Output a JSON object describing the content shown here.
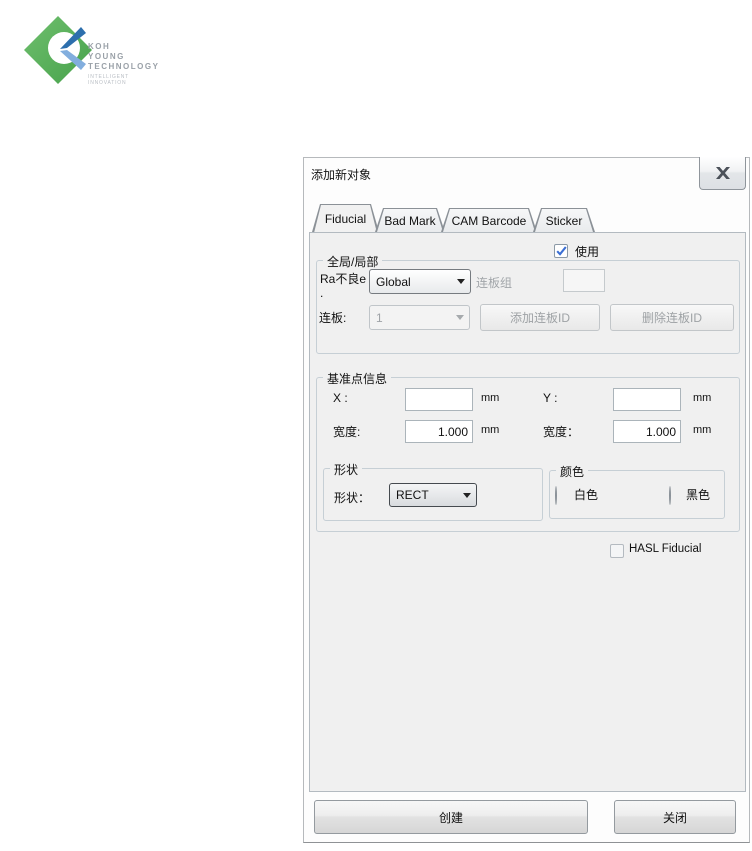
{
  "logo": {
    "brand_lines": [
      "KOH",
      "YOUNG",
      "TECHNOLOGY"
    ],
    "tagline_lines": [
      "INTELLIGENT",
      "INNOVATION"
    ],
    "colors": {
      "green": "#54ad55",
      "blue_dark": "#2d6fad",
      "blue_light": "#82aede"
    }
  },
  "dialog": {
    "title": "添加新对象",
    "tabs": [
      {
        "label": "Fiducial",
        "active": true
      },
      {
        "label": "Bad Mark",
        "active": false
      },
      {
        "label": "CAM Barcode",
        "active": false
      },
      {
        "label": "Sticker",
        "active": false
      }
    ],
    "use_checkbox": {
      "label": "使用",
      "checked": true
    },
    "global_group": {
      "legend": "全局/局部",
      "ra_label_line1": "Ra不良e",
      "ra_label_line2": ".",
      "global_dropdown_value": "Global",
      "panel_group_label": "连板组",
      "panel_group_value": "",
      "panel_label": "连板:",
      "panel_dropdown_value": "1",
      "add_panel_button": "添加连板ID",
      "delete_panel_button": "删除连板ID"
    },
    "fiducial_info_group": {
      "legend": "基准点信息",
      "x_label": "X :",
      "x_value": "",
      "x_unit": "mm",
      "y_label": "Y :",
      "y_value": "",
      "y_unit": "mm",
      "width1_label": "宽度:",
      "width1_value": "1.000",
      "width1_unit": "mm",
      "width2_label": "宽度：",
      "width2_value": "1.000",
      "width2_unit": "mm",
      "shape_group": {
        "legend": "形状",
        "shape_label": "形状：",
        "shape_value": "RECT"
      },
      "color_group": {
        "legend": "颜色",
        "white_label": "白色",
        "black_label": "黑色",
        "selected": "白色"
      }
    },
    "hasl_checkbox": {
      "label": "HASL Fiducial",
      "checked": false
    },
    "create_button": "创建",
    "close_button": "关闭",
    "accent_check_color": "#3b6fd4"
  }
}
